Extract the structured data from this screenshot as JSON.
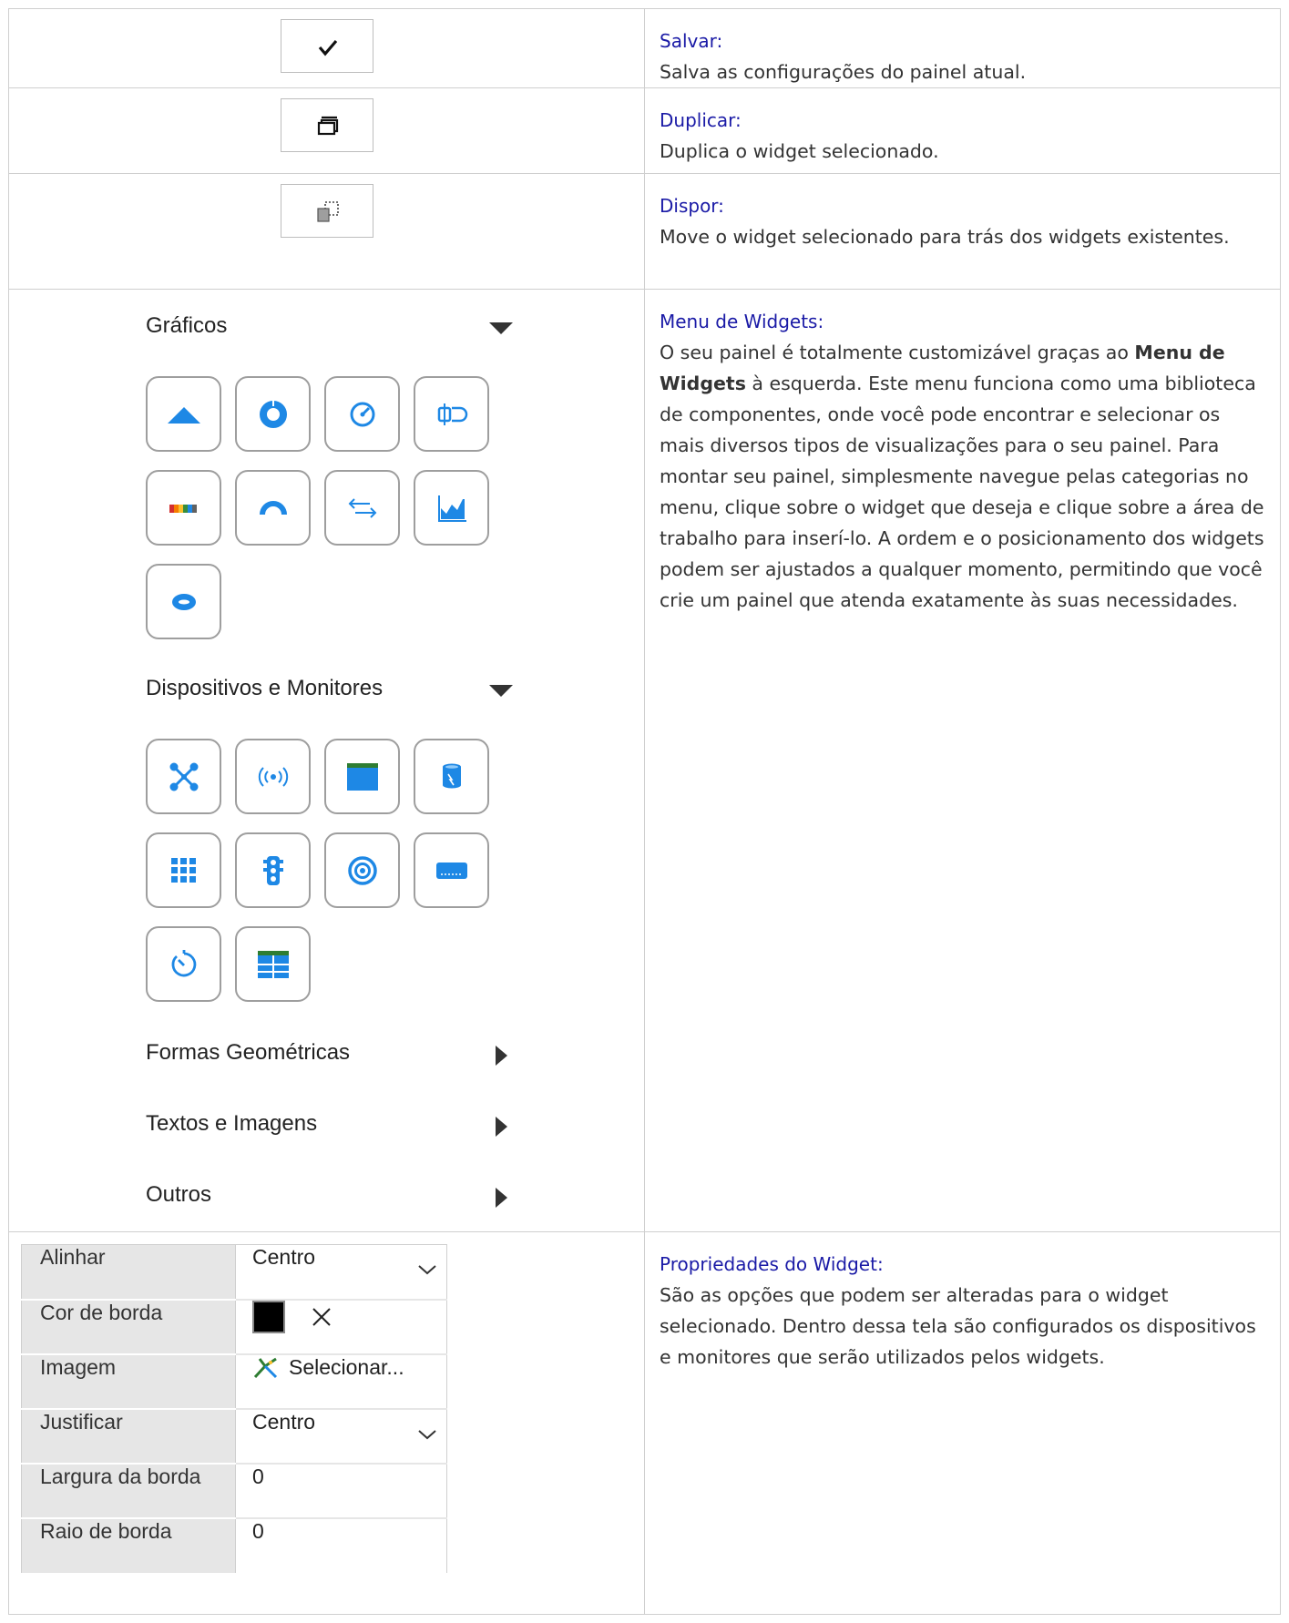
{
  "rows": [
    {
      "term": "Salvar:",
      "desc": "Salva as configurações do painel atual."
    },
    {
      "term": "Duplicar:",
      "desc": "Duplica o widget selecionado."
    },
    {
      "term": "Dispor:",
      "desc": "Move o widget selecionado para trás dos widgets existentes."
    },
    {
      "term": "Menu de Widgets:",
      "desc_before": "O seu painel é totalmente customizável graças ao ",
      "desc_bold": "Menu de Widgets",
      "desc_after": " à esquerda. Este menu funciona como uma biblioteca de componentes, onde você pode encontrar e selecionar os mais diversos tipos de visualizações para o seu painel. Para montar seu painel, simplesmente navegue pelas categorias no menu, clique sobre o widget que deseja e clique sobre a área de trabalho para inserí-lo. A ordem e o posicionamento dos widgets podem ser ajustados a qualquer momento, permitindo que você crie um painel que atenda exatamente às suas necessidades."
    },
    {
      "term": "Propriedades do Widget:",
      "desc": "São as opções que podem ser alteradas para o widget selecionado. Dentro dessa tela são configurados os dispositivos e monitores que serão utilizados pelos widgets."
    }
  ],
  "toolbar_icons": [
    "check-icon",
    "duplicate-icon",
    "arrange-icon"
  ],
  "widget_menu": {
    "categories": [
      {
        "title": "Gráficos",
        "state": "expanded",
        "icons": [
          "area-chart-icon",
          "donut-chart-icon",
          "gauge-icon",
          "toggle-icon",
          "color-bar-icon",
          "half-gauge-icon",
          "arrows-exchange-icon",
          "area-series-icon",
          "ellipse-icon"
        ]
      },
      {
        "title": "Dispositivos e Monitores",
        "state": "expanded",
        "icons": [
          "network-icon",
          "broadcast-icon",
          "window-icon",
          "database-icon",
          "grid-icon",
          "traffic-light-icon",
          "target-icon",
          "badge-icon",
          "timer-icon",
          "table-icon"
        ]
      },
      {
        "title": "Formas Geométricas",
        "state": "collapsed"
      },
      {
        "title": "Textos e Imagens",
        "state": "collapsed"
      },
      {
        "title": "Outros",
        "state": "collapsed"
      }
    ],
    "accent_color": "#1e88e5"
  },
  "properties": [
    {
      "label": "Alinhar",
      "value": "Centro",
      "control": "dropdown"
    },
    {
      "label": "Cor de borda",
      "value": "",
      "control": "color",
      "color": "#000000"
    },
    {
      "label": "Imagem",
      "value": "Selecionar...",
      "control": "image"
    },
    {
      "label": "Justificar",
      "value": "Centro",
      "control": "dropdown"
    },
    {
      "label": "Largura da borda",
      "value": "0",
      "control": "text"
    },
    {
      "label": "Raio de borda",
      "value": "0",
      "control": "text"
    }
  ]
}
